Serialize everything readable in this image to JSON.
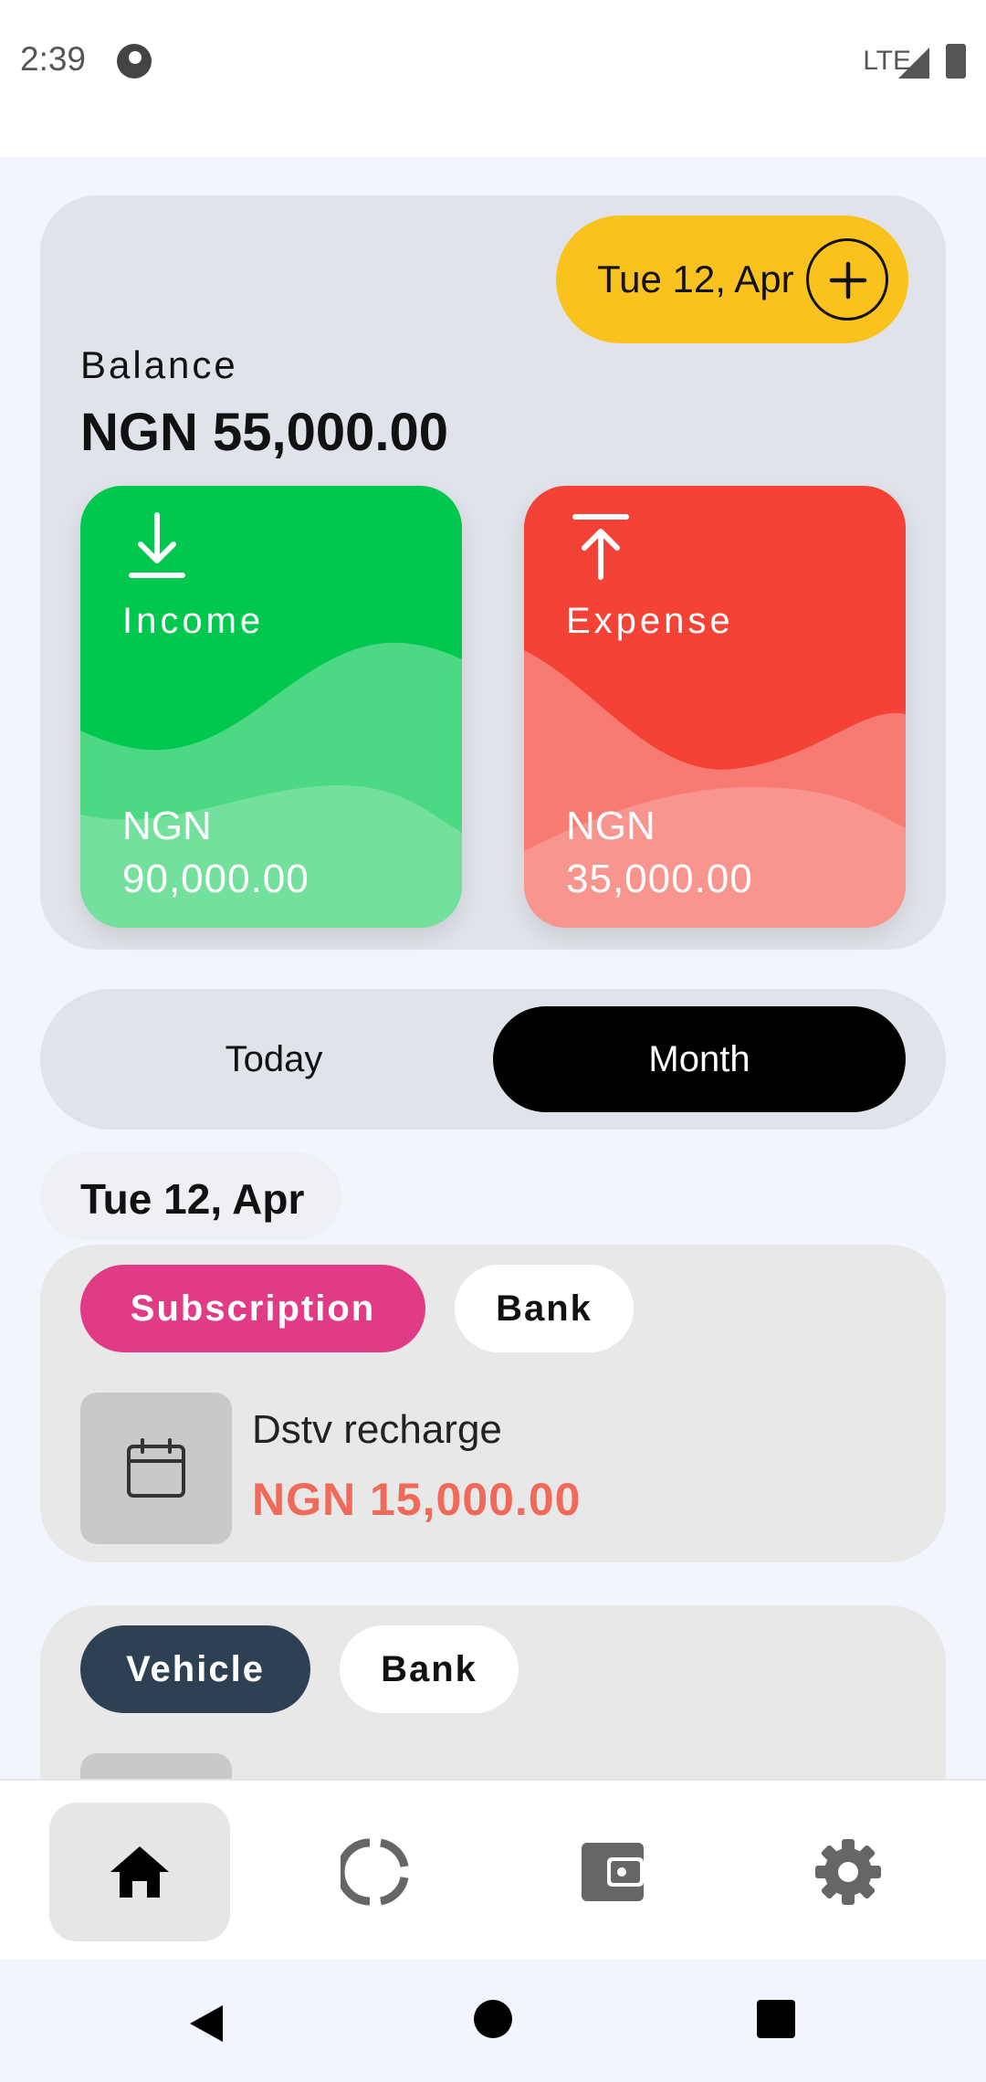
{
  "status_bar": {
    "time": "2:39",
    "network": "LTE",
    "icons": [
      "app-notification-icon",
      "signal-icon",
      "battery-icon"
    ]
  },
  "balance_card": {
    "date_label": "Tue 12, Apr",
    "add_icon": "plus-circle-icon",
    "balance_label": "Balance",
    "balance_value": "NGN 55,000.00"
  },
  "income": {
    "icon": "download-icon",
    "title": "Income",
    "currency": "NGN",
    "amount": "90,000.00",
    "color": "#00c74e"
  },
  "expense": {
    "icon": "upload-icon",
    "title": "Expense",
    "currency": "NGN",
    "amount": "35,000.00",
    "color": "#f44336"
  },
  "period_toggle": {
    "options": [
      "Today",
      "Month"
    ],
    "selected": "Month"
  },
  "section_date": "Tue 12, Apr",
  "transactions": [
    {
      "category": "Subscription",
      "category_color": "#e03b84",
      "account": "Bank",
      "icon": "calendar-icon",
      "name": "Dstv recharge",
      "amount": "NGN 15,000.00"
    },
    {
      "category": "Vehicle",
      "category_color": "#2e4053",
      "account": "Bank"
    }
  ],
  "bottom_nav": {
    "items": [
      "home-icon",
      "stats-icon",
      "wallet-icon",
      "settings-icon"
    ],
    "active": "home-icon"
  },
  "system_nav": [
    "back-icon",
    "home-circle-icon",
    "recent-apps-icon"
  ]
}
